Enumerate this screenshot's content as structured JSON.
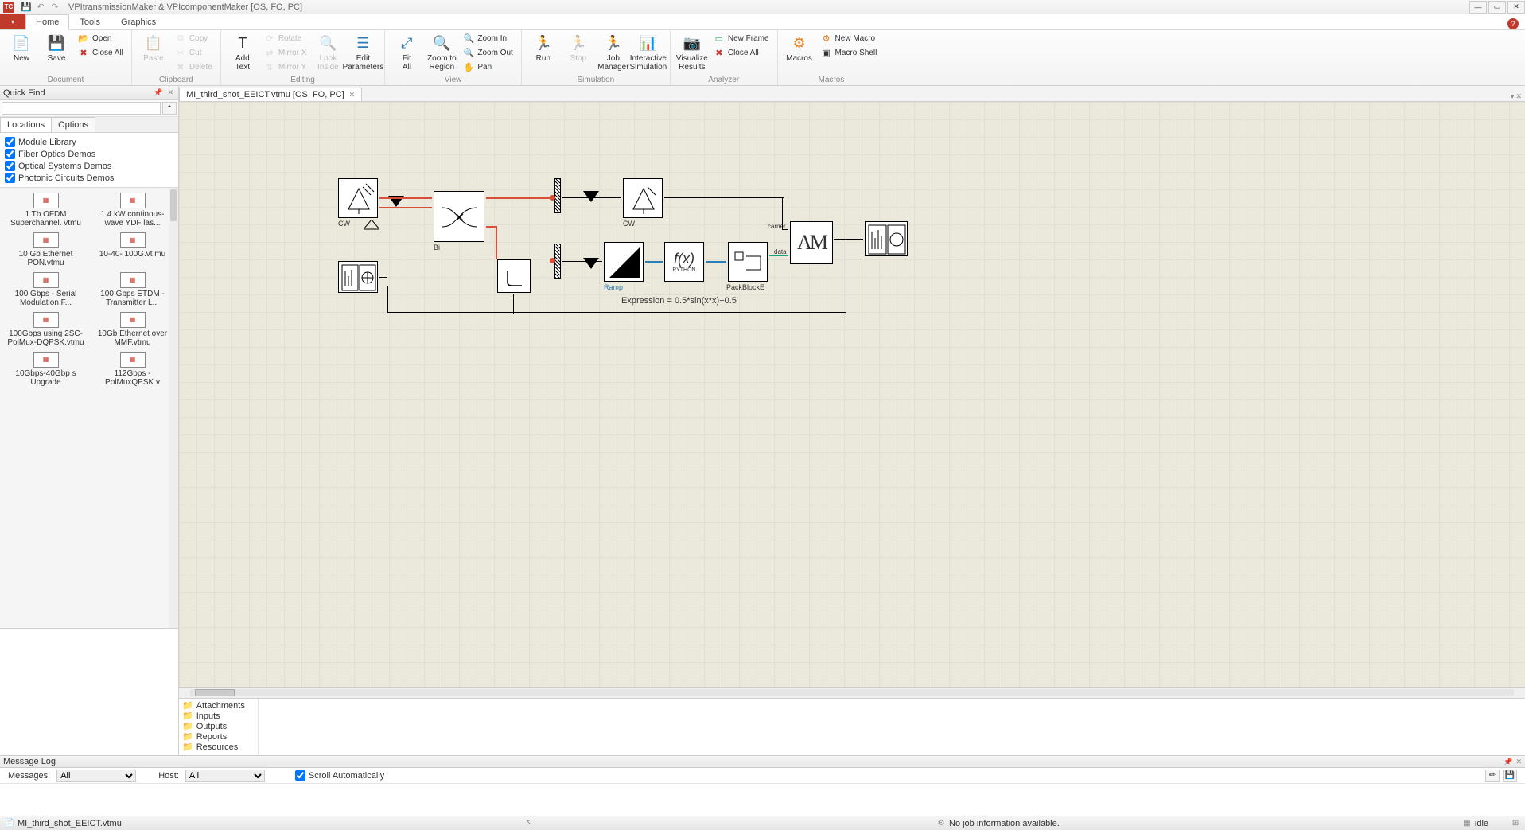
{
  "app": {
    "title": "VPItransmissionMaker & VPIcomponentMaker [OS, FO, PC]"
  },
  "tabs": {
    "file": "",
    "home": "Home",
    "tools": "Tools",
    "graphics": "Graphics"
  },
  "ribbon": {
    "document": {
      "label": "Document",
      "new": "New",
      "save": "Save",
      "open": "Open",
      "close_all": "Close All"
    },
    "clipboard": {
      "label": "Clipboard",
      "paste": "Paste",
      "copy": "Copy",
      "cut": "Cut",
      "delete": "Delete"
    },
    "editing": {
      "label": "Editing",
      "add_text": "Add\nText",
      "rotate": "Rotate",
      "mirror_x": "Mirror X",
      "mirror_y": "Mirror Y",
      "look_inside": "Look\nInside",
      "edit_params": "Edit\nParameters"
    },
    "view": {
      "label": "View",
      "fit_all": "Fit\nAll",
      "zoom_region": "Zoom to\nRegion",
      "zoom_in": "Zoom In",
      "zoom_out": "Zoom Out",
      "pan": "Pan"
    },
    "simulation": {
      "label": "Simulation",
      "run": "Run",
      "stop": "Stop",
      "job_manager": "Job\nManager",
      "interactive": "Interactive\nSimulation"
    },
    "analyzer": {
      "label": "Analyzer",
      "visualize": "Visualize\nResults",
      "new_frame": "New Frame",
      "close_all": "Close All"
    },
    "macros": {
      "label": "Macros",
      "macros": "Macros",
      "new_macro": "New Macro",
      "macro_shell": "Macro Shell"
    }
  },
  "quickfind": {
    "title": "Quick Find",
    "tabs": {
      "locations": "Locations",
      "options": "Options"
    },
    "checks": {
      "module_lib": "Module Library",
      "fiber_demos": "Fiber Optics Demos",
      "optical_demos": "Optical Systems Demos",
      "photonic_demos": "Photonic Circuits Demos"
    },
    "items": [
      "1 Tb OFDM Superchannel. vtmu",
      "1.4 kW continous-wave YDF las...",
      "10 Gb Ethernet PON.vtmu",
      "10-40- 100G.vt mu",
      "100 Gbps - Serial Modulation F...",
      "100 Gbps ETDM - Transmitter L...",
      "100Gbps using 2SC-PolMux-DQPSK.vtmu",
      "10Gb Ethernet over MMF.vtmu",
      "10Gbps-40Gbp s Upgrade",
      "112Gbps - PolMuxQPSK v"
    ]
  },
  "doc": {
    "tab": "MI_third_shot_EEICT.vtmu [OS, FO, PC]"
  },
  "canvas": {
    "cw1": "CW",
    "cw2": "CW",
    "bi": "Bi",
    "ramp": "Ramp",
    "fx": "f(x)",
    "python": "PYTHON",
    "pack": "PackBlockE",
    "am": "AM",
    "carrier": "carrier",
    "data": "data",
    "expression": "Expression = 0.5*sin(x*x)+0.5"
  },
  "tree": {
    "attachments": "Attachments",
    "inputs": "Inputs",
    "outputs": "Outputs",
    "reports": "Reports",
    "resources": "Resources"
  },
  "msglog": {
    "title": "Message Log",
    "messages_label": "Messages:",
    "host_label": "Host:",
    "all": "All",
    "scroll_auto": "Scroll Automatically"
  },
  "status": {
    "file": "MI_third_shot_EEICT.vtmu",
    "job": "No job information available.",
    "idle": "idle"
  }
}
